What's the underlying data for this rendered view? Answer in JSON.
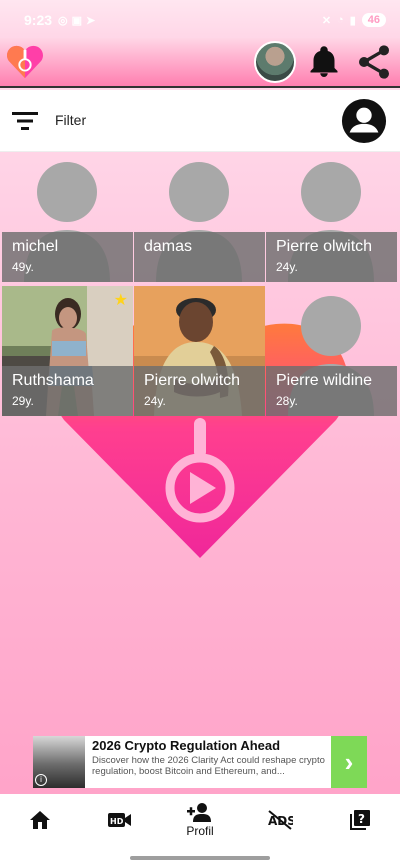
{
  "status": {
    "time": "9:23",
    "battery": "46",
    "icons": [
      "whatsapp-icon",
      "scanner-icon",
      "telegram-icon",
      "mute-icon",
      "wifi-icon",
      "signal-icon"
    ]
  },
  "appbar": {
    "icons": [
      "app-logo",
      "profile-avatar",
      "bell-icon",
      "share-icon"
    ]
  },
  "filter": {
    "label": "Filter"
  },
  "profiles": [
    {
      "name": "michel",
      "age": "49y.",
      "photo": false,
      "starred": false
    },
    {
      "name": "damas",
      "age": "",
      "photo": false,
      "starred": false
    },
    {
      "name": "Pierre olwitch",
      "age": "24y.",
      "photo": false,
      "starred": false
    },
    {
      "name": "Ruthshama",
      "age": "29y.",
      "photo": true,
      "starred": true
    },
    {
      "name": "Pierre olwitch",
      "age": "24y.",
      "photo": true,
      "starred": false
    },
    {
      "name": "Pierre wildine",
      "age": "28y.",
      "photo": false,
      "starred": false
    }
  ],
  "ad": {
    "title": "2026 Crypto Regulation Ahead",
    "description": "Discover how the 2026 Clarity Act could reshape crypto regulation, boost Bitcoin and Ethereum, and...",
    "arrow": "›",
    "info": "i"
  },
  "nav": {
    "items": [
      {
        "icon": "home-icon",
        "label": ""
      },
      {
        "icon": "hd-video-icon",
        "label": ""
      },
      {
        "icon": "person-add-icon",
        "label": "Profil"
      },
      {
        "icon": "ads-off-icon",
        "label": ""
      },
      {
        "icon": "help-library-icon",
        "label": ""
      }
    ]
  },
  "colors": {
    "accent": "#ff2ea1",
    "heart_top": "#ff7a3d",
    "heart_bottom": "#f0279a",
    "label_bg": "#6e6e6e",
    "ad_arrow": "#7ed957"
  }
}
